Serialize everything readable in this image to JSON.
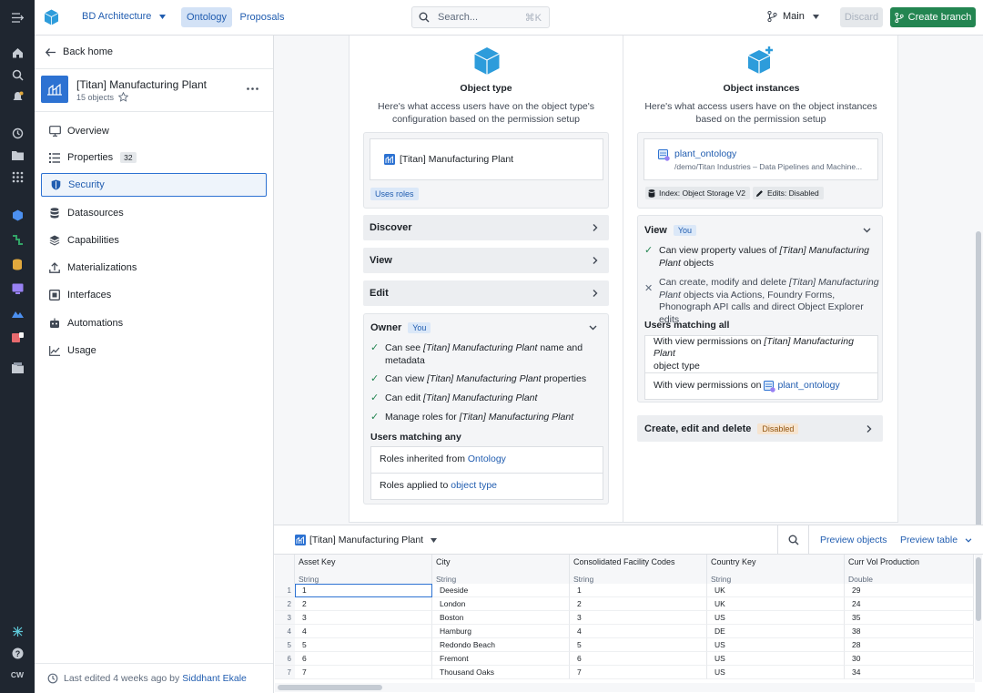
{
  "topbar": {
    "workspace": "BD Architecture",
    "tabs": [
      "Ontology",
      "Proposals"
    ],
    "search_placeholder": "Search...",
    "search_shortcut": "⌘K",
    "branch": "Main",
    "discard_label": "Discard",
    "create_branch_label": "Create branch"
  },
  "sidebar": {
    "back_label": "Back home",
    "object_title": "[Titan] Manufacturing Plant",
    "object_count": "15 objects",
    "items": [
      {
        "label": "Overview",
        "icon": "monitor-icon"
      },
      {
        "label": "Properties",
        "icon": "list-icon",
        "badge": "32"
      },
      {
        "label": "Security",
        "icon": "shield-icon"
      },
      {
        "label": "Datasources",
        "icon": "database-icon"
      },
      {
        "label": "Capabilities",
        "icon": "layers-icon"
      },
      {
        "label": "Materializations",
        "icon": "upload-icon"
      },
      {
        "label": "Interfaces",
        "icon": "interface-icon"
      },
      {
        "label": "Automations",
        "icon": "robot-icon"
      },
      {
        "label": "Usage",
        "icon": "chart-icon"
      }
    ],
    "footer_prefix": "Last edited 4 weeks ago by",
    "footer_user": "Siddhant Ekale"
  },
  "object_type": {
    "title": "Object type",
    "description": "Here's what access users have on the object type's configuration based on the permission setup",
    "resource_name": "[Titan] Manufacturing Plant",
    "uses_roles": "Uses roles",
    "rows": [
      "Discover",
      "View",
      "Edit"
    ],
    "owner_label": "Owner",
    "you_tag": "You",
    "owner_perms": [
      {
        "pre": "Can see ",
        "em": "[Titan] Manufacturing Plant",
        "post": " name and metadata"
      },
      {
        "pre": "Can view ",
        "em": "[Titan] Manufacturing Plant",
        "post": " properties"
      },
      {
        "pre": "Can edit ",
        "em": "[Titan] Manufacturing Plant",
        "post": ""
      },
      {
        "pre": "Manage roles for ",
        "em": "[Titan] Manufacturing Plant",
        "post": ""
      }
    ],
    "users_matching": "Users matching any",
    "roles_inherited_prefix": "Roles inherited from",
    "roles_inherited_link": "Ontology",
    "roles_applied_prefix": "Roles applied to",
    "roles_applied_link": "object type"
  },
  "object_instances": {
    "title": "Object instances",
    "description": "Here's what access users have on the object instances based on the permission setup",
    "dataset_name": "plant_ontology",
    "dataset_path": "/demo/Titan Industries – Data Pipelines and Machine...",
    "index_tag": "Index: Object Storage V2",
    "edits_tag": "Edits: Disabled",
    "view_label": "View",
    "you_tag": "You",
    "perm1": {
      "pre": "Can view property values of ",
      "em": "[Titan] Manufacturing",
      "post_em": "Plant",
      "post": " objects"
    },
    "perm2": {
      "pre": "Can create, modify and delete ",
      "em": "[Titan] Manufacturing",
      "em2": "Plant",
      "post": " objects via Actions, Foundry Forms, Phonograph API calls and direct Object Explorer edits"
    },
    "users_matching_all": "Users matching all",
    "with_view1_prefix": "With view permissions on",
    "with_view1_em": "[Titan] Manufacturing Plant",
    "with_view1_suffix": "object type",
    "with_view2_prefix": "With view permissions on",
    "with_view2_link": "plant_ontology",
    "ced_label": "Create, edit and delete",
    "disabled_tag": "Disabled"
  },
  "preview": {
    "object_selector": "[Titan] Manufacturing Plant",
    "preview_objects": "Preview objects",
    "preview_table": "Preview table",
    "columns": [
      {
        "name": "Asset Key",
        "type": "String"
      },
      {
        "name": "City",
        "type": "String"
      },
      {
        "name": "Consolidated Facility Codes",
        "type": "String"
      },
      {
        "name": "Country Key",
        "type": "String"
      },
      {
        "name": "Curr Vol Production",
        "type": "Double"
      }
    ],
    "rows": [
      [
        "1",
        "1",
        "Deeside",
        "1",
        "UK",
        "29"
      ],
      [
        "2",
        "2",
        "London",
        "2",
        "UK",
        "24"
      ],
      [
        "3",
        "3",
        "Boston",
        "3",
        "US",
        "35"
      ],
      [
        "4",
        "4",
        "Hamburg",
        "4",
        "DE",
        "38"
      ],
      [
        "5",
        "5",
        "Redondo Beach",
        "5",
        "US",
        "28"
      ],
      [
        "6",
        "6",
        "Fremont",
        "6",
        "US",
        "30"
      ],
      [
        "7",
        "7",
        "Thousand Oaks",
        "7",
        "US",
        "34"
      ]
    ]
  },
  "rail": {
    "user_initials": "CW"
  },
  "colors": {
    "rail_bg": "#1f2630",
    "accent": "#2d72d2",
    "create_branch": "#238551",
    "object_icon": "#2d9cdb"
  }
}
